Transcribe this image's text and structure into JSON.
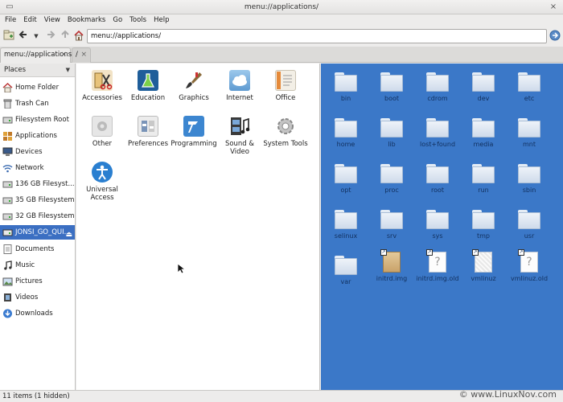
{
  "window": {
    "title": "menu://applications/"
  },
  "menu": [
    "File",
    "Edit",
    "View",
    "Bookmarks",
    "Go",
    "Tools",
    "Help"
  ],
  "location": {
    "value": "menu://applications/"
  },
  "tabs": [
    {
      "label": "menu://applications/",
      "close": "×"
    },
    {
      "label": "/",
      "close": "×"
    }
  ],
  "sidebar": {
    "header": "Places",
    "items": [
      {
        "label": "Home Folder",
        "icon": "home-icon"
      },
      {
        "label": "Trash Can",
        "icon": "trash-icon"
      },
      {
        "label": "Filesystem Root",
        "icon": "drive-icon"
      },
      {
        "label": "Applications",
        "icon": "applications-icon"
      },
      {
        "label": "Devices",
        "icon": "computer-icon"
      },
      {
        "label": "Network",
        "icon": "network-icon"
      },
      {
        "label": "136 GB Filesyst...",
        "icon": "drive-icon"
      },
      {
        "label": "35 GB Filesystem",
        "icon": "drive-icon"
      },
      {
        "label": "32 GB Filesystem",
        "icon": "drive-icon"
      },
      {
        "label": "JONSI_GO_QUI...",
        "icon": "drive-icon",
        "selected": true
      },
      {
        "label": "Documents",
        "icon": "documents-icon"
      },
      {
        "label": "Music",
        "icon": "music-icon"
      },
      {
        "label": "Pictures",
        "icon": "pictures-icon"
      },
      {
        "label": "Videos",
        "icon": "videos-icon"
      },
      {
        "label": "Downloads",
        "icon": "downloads-icon"
      }
    ]
  },
  "apps": [
    {
      "label": "Accessories",
      "icon": "accessories-icon",
      "color": "#c98b2a"
    },
    {
      "label": "Education",
      "icon": "education-icon",
      "color": "#1f6aa8"
    },
    {
      "label": "Graphics",
      "icon": "graphics-icon",
      "color": "#8a6a3a"
    },
    {
      "label": "Internet",
      "icon": "internet-icon",
      "color": "#7ab3de"
    },
    {
      "label": "Office",
      "icon": "office-icon",
      "color": "#e8e2d8"
    },
    {
      "label": "Other",
      "icon": "other-icon",
      "color": "#d8d8d8"
    },
    {
      "label": "Preferences",
      "icon": "preferences-icon",
      "color": "#dcdcdc"
    },
    {
      "label": "Programming",
      "icon": "programming-icon",
      "color": "#3c86d0"
    },
    {
      "label": "Sound & Video",
      "icon": "sound-video-icon",
      "color": "#4a4a4a"
    },
    {
      "label": "System Tools",
      "icon": "system-tools-icon",
      "color": "#b8b8b8"
    },
    {
      "label": "Universal Access",
      "icon": "universal-access-icon",
      "color": "#2a7fd0"
    }
  ],
  "files": [
    {
      "label": "bin",
      "type": "folder"
    },
    {
      "label": "boot",
      "type": "folder"
    },
    {
      "label": "cdrom",
      "type": "folder"
    },
    {
      "label": "dev",
      "type": "folder"
    },
    {
      "label": "etc",
      "type": "folder"
    },
    {
      "label": "home",
      "type": "folder"
    },
    {
      "label": "lib",
      "type": "folder"
    },
    {
      "label": "lost+found",
      "type": "folder"
    },
    {
      "label": "media",
      "type": "folder"
    },
    {
      "label": "mnt",
      "type": "folder"
    },
    {
      "label": "opt",
      "type": "folder"
    },
    {
      "label": "proc",
      "type": "folder"
    },
    {
      "label": "root",
      "type": "folder"
    },
    {
      "label": "run",
      "type": "folder"
    },
    {
      "label": "sbin",
      "type": "folder"
    },
    {
      "label": "selinux",
      "type": "folder"
    },
    {
      "label": "srv",
      "type": "folder"
    },
    {
      "label": "sys",
      "type": "folder"
    },
    {
      "label": "tmp",
      "type": "folder"
    },
    {
      "label": "usr",
      "type": "folder"
    },
    {
      "label": "var",
      "type": "folder"
    },
    {
      "label": "initrd.img",
      "type": "archive-link"
    },
    {
      "label": "initrd.img.old",
      "type": "unknown-link"
    },
    {
      "label": "vmlinuz",
      "type": "binary-link"
    },
    {
      "label": "vmlinuz.old",
      "type": "unknown-link"
    }
  ],
  "status": {
    "text": "11 items (1 hidden)"
  },
  "watermark": "© www.LinuxNov.com",
  "colors": {
    "selection": "#3b6fc2",
    "right_panel": "#3b78c8"
  }
}
